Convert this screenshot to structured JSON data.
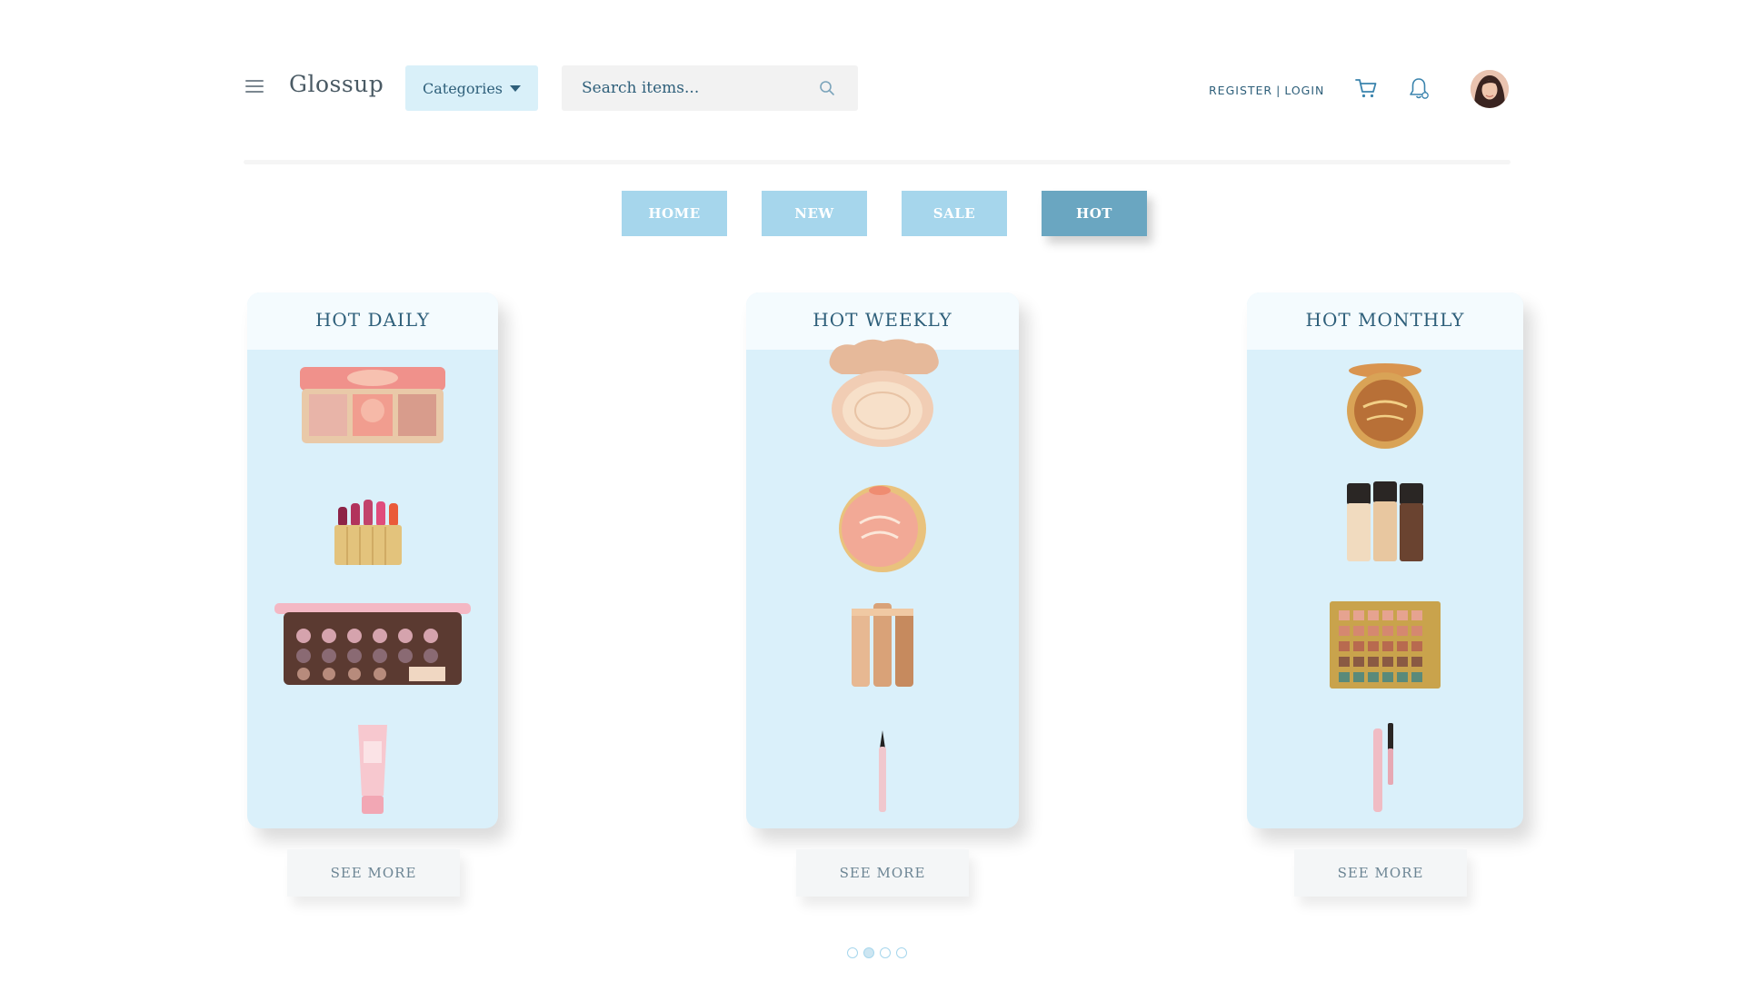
{
  "header": {
    "logo": "Glossup",
    "categories_label": "Categories",
    "search_placeholder": "Search items...",
    "register_label": "REGISTER",
    "separator": "|",
    "login_label": "LOGIN"
  },
  "tabs": [
    {
      "label": "HOME",
      "active": false
    },
    {
      "label": "NEW",
      "active": false
    },
    {
      "label": "SALE",
      "active": false
    },
    {
      "label": "HOT",
      "active": true
    }
  ],
  "cards": [
    {
      "title": "HOT DAILY",
      "see_more": "SEE MORE",
      "products": [
        "eyeshadow-palette-icon",
        "lipstick-set-icon",
        "chocolate-palette-icon",
        "primer-tube-icon"
      ]
    },
    {
      "title": "HOT WEEKLY",
      "see_more": "SEE MORE",
      "products": [
        "compact-powder-icon",
        "peach-blush-icon",
        "foundation-set-icon",
        "eyeliner-pen-icon"
      ]
    },
    {
      "title": "HOT MONTHLY",
      "see_more": "SEE MORE",
      "products": [
        "bronzer-compact-icon",
        "foundation-bottles-icon",
        "gold-palette-icon",
        "mascara-icon"
      ]
    }
  ],
  "pagination": {
    "total": 4,
    "active_index": 1
  },
  "colors": {
    "accent": "#a6d6ec",
    "active_tab": "#6aa6c1",
    "card_bg": "#daf0fa",
    "text": "#2e5f7a"
  }
}
